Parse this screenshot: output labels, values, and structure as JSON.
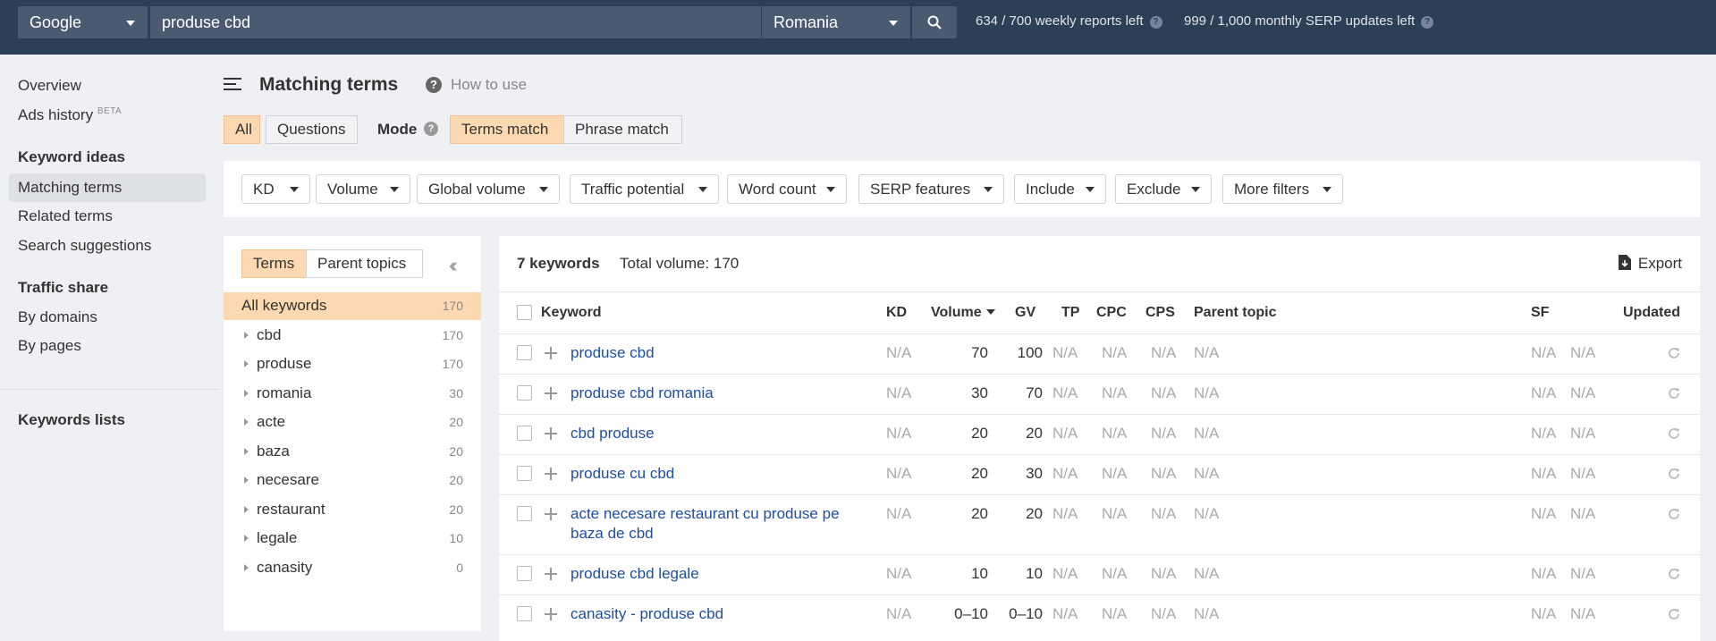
{
  "topbar": {
    "engine": "Google",
    "query": "produse cbd",
    "country": "Romania",
    "weekly_reports": "634 / 700 weekly reports left",
    "serp_updates": "999 / 1,000 monthly SERP updates left"
  },
  "sidebar": {
    "overview": "Overview",
    "ads_history": "Ads history",
    "beta": "BETA",
    "keyword_ideas": "Keyword ideas",
    "matching_terms": "Matching terms",
    "related_terms": "Related terms",
    "search_suggestions": "Search suggestions",
    "traffic_share": "Traffic share",
    "by_domains": "By domains",
    "by_pages": "By pages",
    "keywords_lists": "Keywords lists"
  },
  "header": {
    "title": "Matching terms",
    "how_to_use": "How to use"
  },
  "tabs": {
    "all": "All",
    "questions": "Questions",
    "mode": "Mode",
    "terms_match": "Terms match",
    "phrase_match": "Phrase match"
  },
  "filters": [
    "KD",
    "Volume",
    "Global volume",
    "Traffic potential",
    "Word count",
    "SERP features",
    "Include",
    "Exclude",
    "More filters"
  ],
  "left_panel": {
    "terms_tab": "Terms",
    "parent_topics_tab": "Parent topics",
    "all_keywords": {
      "label": "All keywords",
      "count": "170"
    },
    "items": [
      {
        "label": "cbd",
        "count": "170"
      },
      {
        "label": "produse",
        "count": "170"
      },
      {
        "label": "romania",
        "count": "30"
      },
      {
        "label": "acte",
        "count": "20"
      },
      {
        "label": "baza",
        "count": "20"
      },
      {
        "label": "necesare",
        "count": "20"
      },
      {
        "label": "restaurant",
        "count": "20"
      },
      {
        "label": "legale",
        "count": "10"
      },
      {
        "label": "canasity",
        "count": "0"
      }
    ]
  },
  "results": {
    "count": "7 keywords",
    "total_volume": "Total volume: 170",
    "export": "Export",
    "headers": {
      "keyword": "Keyword",
      "kd": "KD",
      "volume": "Volume",
      "gv": "GV",
      "tp": "TP",
      "cpc": "CPC",
      "cps": "CPS",
      "parent_topic": "Parent topic",
      "sf": "SF",
      "updated": "Updated"
    },
    "rows": [
      {
        "keyword": "produse cbd",
        "kd": "N/A",
        "volume": "70",
        "gv": "100",
        "tp": "N/A",
        "cpc": "N/A",
        "cps": "N/A",
        "parent": "N/A",
        "sf": "N/A",
        "sf2": "N/A"
      },
      {
        "keyword": "produse cbd romania",
        "kd": "N/A",
        "volume": "30",
        "gv": "70",
        "tp": "N/A",
        "cpc": "N/A",
        "cps": "N/A",
        "parent": "N/A",
        "sf": "N/A",
        "sf2": "N/A"
      },
      {
        "keyword": "cbd produse",
        "kd": "N/A",
        "volume": "20",
        "gv": "20",
        "tp": "N/A",
        "cpc": "N/A",
        "cps": "N/A",
        "parent": "N/A",
        "sf": "N/A",
        "sf2": "N/A"
      },
      {
        "keyword": "produse cu cbd",
        "kd": "N/A",
        "volume": "20",
        "gv": "30",
        "tp": "N/A",
        "cpc": "N/A",
        "cps": "N/A",
        "parent": "N/A",
        "sf": "N/A",
        "sf2": "N/A"
      },
      {
        "keyword": "acte necesare restaurant cu produse pe baza de cbd",
        "kd": "N/A",
        "volume": "20",
        "gv": "20",
        "tp": "N/A",
        "cpc": "N/A",
        "cps": "N/A",
        "parent": "N/A",
        "sf": "N/A",
        "sf2": "N/A"
      },
      {
        "keyword": "produse cbd legale",
        "kd": "N/A",
        "volume": "10",
        "gv": "10",
        "tp": "N/A",
        "cpc": "N/A",
        "cps": "N/A",
        "parent": "N/A",
        "sf": "N/A",
        "sf2": "N/A"
      },
      {
        "keyword": "canasity - produse cbd",
        "kd": "N/A",
        "volume": "0–10",
        "gv": "0–10",
        "tp": "N/A",
        "cpc": "N/A",
        "cps": "N/A",
        "parent": "N/A",
        "sf": "N/A",
        "sf2": "N/A"
      }
    ]
  }
}
